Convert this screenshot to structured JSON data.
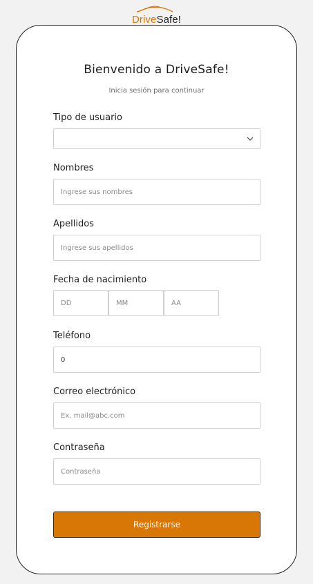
{
  "logo": {
    "drive": "Drive",
    "safe": "Safe!"
  },
  "header": {
    "title": "Bienvenido a DriveSafe!",
    "subtitle": "Inicia sesión para continuar"
  },
  "form": {
    "user_type": {
      "label": "Tipo de usuario",
      "value": ""
    },
    "names": {
      "label": "Nombres",
      "placeholder": "Ingrese sus nombres"
    },
    "surnames": {
      "label": "Apellidos",
      "placeholder": "Ingrese sus apellidos"
    },
    "birthdate": {
      "label": "Fecha de nacimiento",
      "day_placeholder": "DD",
      "month_placeholder": "MM",
      "year_placeholder": "AA"
    },
    "phone": {
      "label": "Teléfono",
      "value": "0"
    },
    "email": {
      "label": "Correo electrónico",
      "placeholder": "Ex. mail@abc.com"
    },
    "password": {
      "label": "Contraseña",
      "placeholder": "Contraseña"
    },
    "submit_label": "Registrarse"
  },
  "colors": {
    "accent": "#d97706",
    "border": "#cfcfcf",
    "text": "#1f1f1f"
  },
  "icons": {
    "select_arrow": "chevron-down-icon",
    "logo_car": "car-outline-icon"
  }
}
